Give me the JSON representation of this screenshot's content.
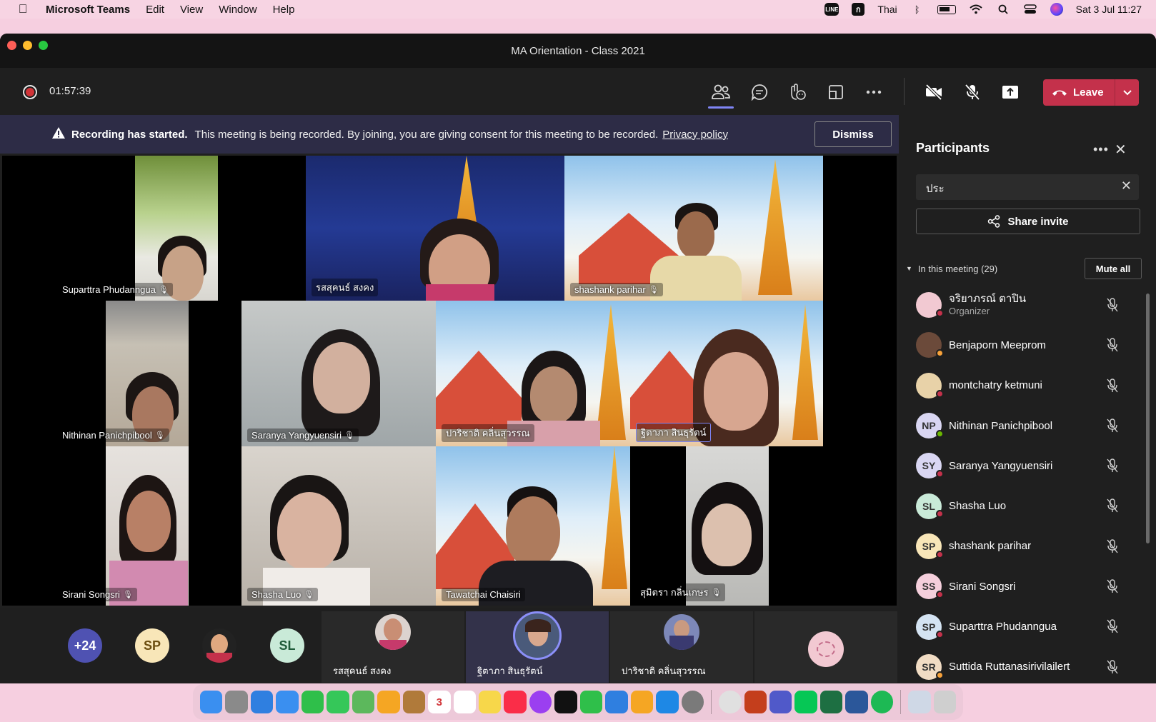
{
  "menubar": {
    "app_name": "Microsoft Teams",
    "menus": [
      "Edit",
      "View",
      "Window",
      "Help"
    ],
    "input_source": "Thai",
    "datetime": "Sat 3 Jul  11:27"
  },
  "window": {
    "title": "MA Orientation - Class 2021"
  },
  "toolbar": {
    "timer": "01:57:39",
    "leave_label": "Leave"
  },
  "banner": {
    "bold": "Recording has started.",
    "text": "This meeting is being recorded. By joining, you are giving consent for this meeting to be recorded.",
    "link": "Privacy policy",
    "dismiss": "Dismiss"
  },
  "videos": [
    {
      "name": "Suparttra Phudanngua"
    },
    {
      "name": "รสสุคนธ์ สงคง"
    },
    {
      "name": "shashank parihar"
    },
    {
      "name": "Nithinan Panichpibool"
    },
    {
      "name": "Saranya  Yangyuensiri"
    },
    {
      "name": "ปาริชาติ คลิ่นสุวรรณ"
    },
    {
      "name": "ฐิตาภา  สินธุรัตน์"
    },
    {
      "name": "Sirani  Songsri"
    },
    {
      "name": "Shasha Luo"
    },
    {
      "name": "Tawatchai Chaisiri"
    },
    {
      "name": "สุมิตรา กลิ่นเกษร"
    }
  ],
  "strip": {
    "more": "+24",
    "sp": "SP",
    "sl": "SL",
    "names": [
      "รสสุคนธ์ สงคง",
      "ฐิตาภา สินธุรัตน์",
      "ปาริชาติ คลิ่นสุวรรณ"
    ]
  },
  "panel": {
    "title": "Participants",
    "search_value": "ประ",
    "share_invite": "Share invite",
    "section": "In this meeting (29)",
    "mute_all": "Mute all",
    "participants": [
      {
        "name": "จริยาภรณ์ ตาปิน",
        "role": "Organizer",
        "initials": "",
        "color": "#f2c9d2",
        "status": "#c4314b"
      },
      {
        "name": "Benjaporn Meeprom",
        "role": "",
        "initials": "",
        "color": "#6b4a3a",
        "status": "#f8a23a"
      },
      {
        "name": "montchatry ketmuni",
        "role": "",
        "initials": "",
        "color": "#e8d2a8",
        "status": "#c4314b"
      },
      {
        "name": "Nithinan Panichpibool",
        "role": "",
        "initials": "NP",
        "color": "#d9d6f2",
        "status": "#6bb700"
      },
      {
        "name": "Saranya Yangyuensiri",
        "role": "",
        "initials": "SY",
        "color": "#d9d6f2",
        "status": "#c4314b"
      },
      {
        "name": "Shasha Luo",
        "role": "",
        "initials": "SL",
        "color": "#c9ead8",
        "status": "#c4314b"
      },
      {
        "name": "shashank parihar",
        "role": "",
        "initials": "SP",
        "color": "#f8e6b8",
        "status": "#c4314b"
      },
      {
        "name": "Sirani Songsri",
        "role": "",
        "initials": "SS",
        "color": "#f5cfdc",
        "status": "#c4314b"
      },
      {
        "name": "Suparttra Phudanngua",
        "role": "",
        "initials": "SP",
        "color": "#d4e3f2",
        "status": "#c4314b"
      },
      {
        "name": "Suttida Ruttanasirivilailert",
        "role": "",
        "initials": "SR",
        "color": "#f1dcc4",
        "status": "#f8a23a"
      }
    ]
  },
  "dock": {
    "calendar_day": "3",
    "apps": [
      "finder-icon",
      "launchpad-icon",
      "safari-icon",
      "mail-icon",
      "facetime-icon",
      "messages-icon",
      "maps-icon",
      "photos-icon",
      "notes-icon",
      "calendar-icon",
      "reminders-icon",
      "stickies-icon",
      "music-icon",
      "podcasts-icon",
      "tv-icon",
      "numbers-icon",
      "keynote-icon",
      "pages-icon",
      "appstore-icon",
      "settings-icon",
      "chrome-icon",
      "powerpoint-icon",
      "teams-icon",
      "line-icon",
      "excel-icon",
      "word-icon",
      "spotify-icon",
      "preview-icon",
      "trash-icon"
    ]
  }
}
